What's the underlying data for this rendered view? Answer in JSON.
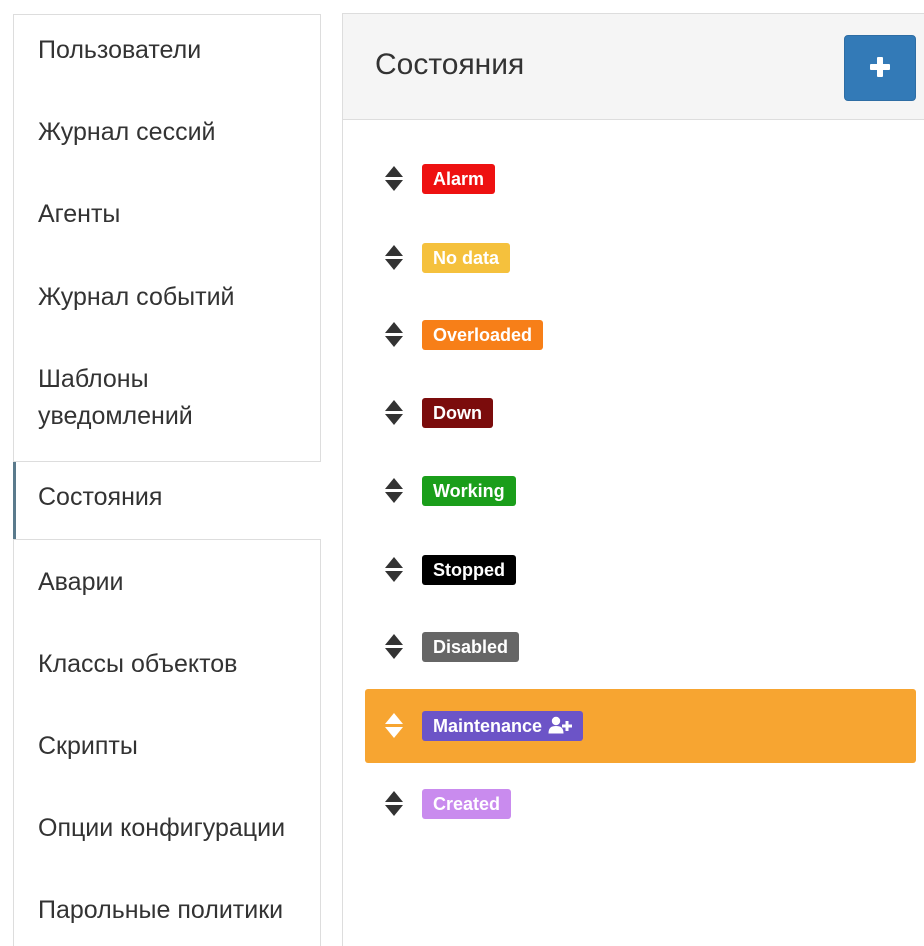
{
  "sidebar": {
    "items": [
      {
        "label": "Пользователи"
      },
      {
        "label": "Журнал сессий"
      },
      {
        "label": "Агенты"
      },
      {
        "label": "Журнал событий"
      },
      {
        "label": "Шаблоны",
        "label2": "уведомлений"
      },
      {
        "label": "Состояния",
        "active": true
      },
      {
        "label": "Аварии"
      },
      {
        "label": "Классы объектов"
      },
      {
        "label": "Скрипты"
      },
      {
        "label": "Опции конфигурации"
      },
      {
        "label": "Парольные политики"
      }
    ]
  },
  "panel": {
    "title": "Состояния",
    "add_button_icon": "plus-icon"
  },
  "states": [
    {
      "label": "Alarm",
      "color": "#ee1111"
    },
    {
      "label": "No data",
      "color": "#f5c13d"
    },
    {
      "label": "Overloaded",
      "color": "#f77f18"
    },
    {
      "label": "Down",
      "color": "#7b0c0c"
    },
    {
      "label": "Working",
      "color": "#1a9e1a"
    },
    {
      "label": "Stopped",
      "color": "#000000"
    },
    {
      "label": "Disabled",
      "color": "#666666"
    },
    {
      "label": "Maintenance",
      "color": "#6c54c7",
      "selected": true,
      "icon": "user-plus-icon"
    },
    {
      "label": "Created",
      "color": "#c98bee"
    }
  ],
  "colors": {
    "selected_row": "#f7a531",
    "primary_button": "#337ab7",
    "active_border": "#5a7a8c"
  }
}
